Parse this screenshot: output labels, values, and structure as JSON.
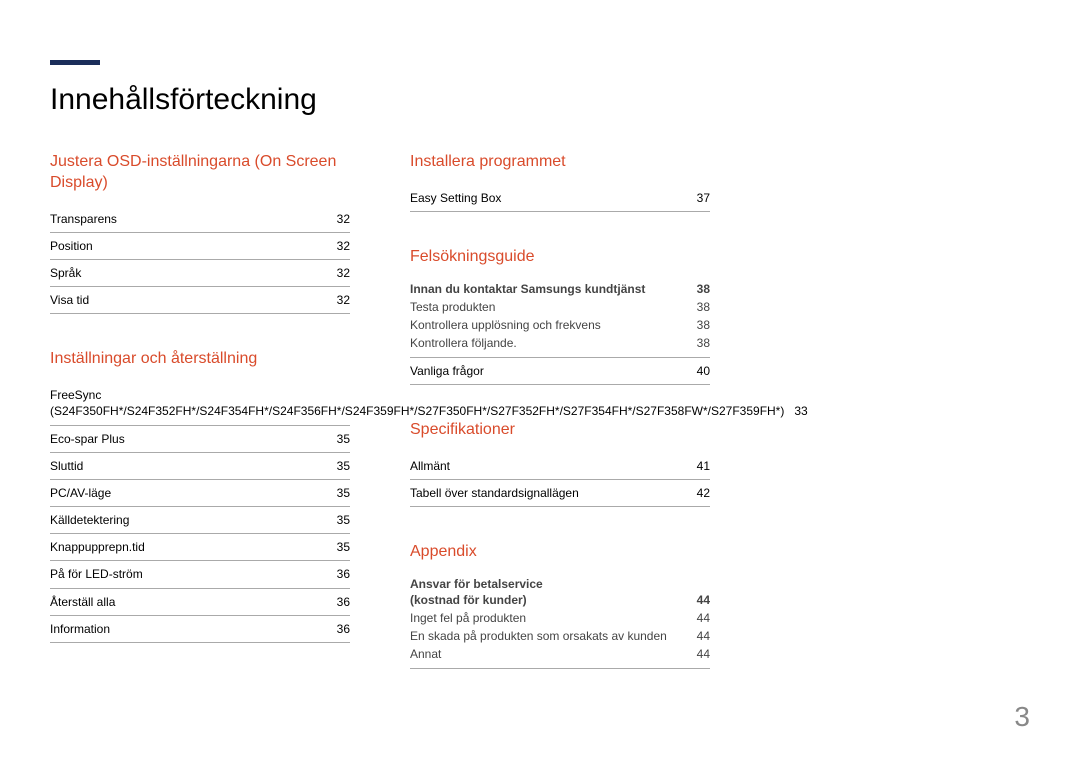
{
  "title": "Innehållsförteckning",
  "pageNumber": "3",
  "col1": {
    "sec1": {
      "heading": "Justera OSD-inställningarna (On Screen Display)",
      "r1": {
        "label": "Transparens",
        "page": "32"
      },
      "r2": {
        "label": "Position",
        "page": "32"
      },
      "r3": {
        "label": "Språk",
        "page": "32"
      },
      "r4": {
        "label": "Visa tid",
        "page": "32"
      }
    },
    "sec2": {
      "heading": "Inställningar och återställning",
      "r1": {
        "label": "FreeSync (S24F350FH*/S24F352FH*/S24F354FH*/S24F356FH*/S24F359FH*/S27F350FH*/S27F352FH*/S27F354FH*/S27F358FW*/S27F359FH*)",
        "page": "33"
      },
      "r2": {
        "label": "Eco-spar Plus",
        "page": "35"
      },
      "r3": {
        "label": "Sluttid",
        "page": "35"
      },
      "r4": {
        "label": "PC/AV-läge",
        "page": "35"
      },
      "r5": {
        "label": "Källdetektering",
        "page": "35"
      },
      "r6": {
        "label": "Knappupprepn.tid",
        "page": "35"
      },
      "r7": {
        "label": "På för LED-ström",
        "page": "36"
      },
      "r8": {
        "label": "Återställ alla",
        "page": "36"
      },
      "r9": {
        "label": "Information",
        "page": "36"
      }
    }
  },
  "col2": {
    "sec1": {
      "heading": "Installera programmet",
      "r1": {
        "label": "Easy Setting Box",
        "page": "37"
      }
    },
    "sec2": {
      "heading": "Felsökningsguide",
      "g1": {
        "rMain": {
          "label": "Innan du kontaktar Samsungs kundtjänst",
          "page": "38"
        },
        "s1": {
          "label": "Testa produkten",
          "page": "38"
        },
        "s2": {
          "label": "Kontrollera upplösning och frekvens",
          "page": "38"
        },
        "s3": {
          "label": "Kontrollera följande.",
          "page": "38"
        }
      },
      "r2": {
        "label": "Vanliga frågor",
        "page": "40"
      }
    },
    "sec3": {
      "heading": "Specifikationer",
      "r1": {
        "label": "Allmänt",
        "page": "41"
      },
      "r2": {
        "label": "Tabell över standardsignallägen",
        "page": "42"
      }
    },
    "sec4": {
      "heading": "Appendix",
      "g1": {
        "rMainA": {
          "label": "Ansvar för betalservice"
        },
        "rMainB": {
          "label": "(kostnad för kunder)",
          "page": "44"
        },
        "s1": {
          "label": "Inget fel på produkten",
          "page": "44"
        },
        "s2": {
          "label": "En skada på produkten som orsakats av kunden",
          "page": "44"
        },
        "s3": {
          "label": "Annat",
          "page": "44"
        }
      }
    }
  }
}
